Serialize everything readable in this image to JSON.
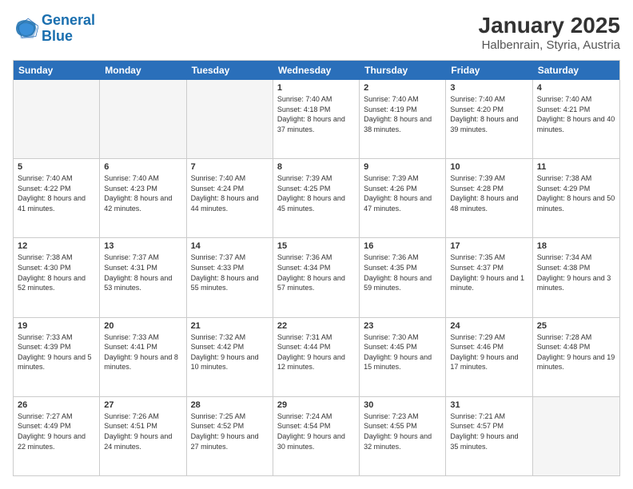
{
  "logo": {
    "line1": "General",
    "line2": "Blue"
  },
  "title": "January 2025",
  "subtitle": "Halbenrain, Styria, Austria",
  "header_days": [
    "Sunday",
    "Monday",
    "Tuesday",
    "Wednesday",
    "Thursday",
    "Friday",
    "Saturday"
  ],
  "rows": [
    [
      {
        "day": "",
        "info": "",
        "empty": true
      },
      {
        "day": "",
        "info": "",
        "empty": true
      },
      {
        "day": "",
        "info": "",
        "empty": true
      },
      {
        "day": "1",
        "info": "Sunrise: 7:40 AM\nSunset: 4:18 PM\nDaylight: 8 hours and 37 minutes."
      },
      {
        "day": "2",
        "info": "Sunrise: 7:40 AM\nSunset: 4:19 PM\nDaylight: 8 hours and 38 minutes."
      },
      {
        "day": "3",
        "info": "Sunrise: 7:40 AM\nSunset: 4:20 PM\nDaylight: 8 hours and 39 minutes."
      },
      {
        "day": "4",
        "info": "Sunrise: 7:40 AM\nSunset: 4:21 PM\nDaylight: 8 hours and 40 minutes."
      }
    ],
    [
      {
        "day": "5",
        "info": "Sunrise: 7:40 AM\nSunset: 4:22 PM\nDaylight: 8 hours and 41 minutes."
      },
      {
        "day": "6",
        "info": "Sunrise: 7:40 AM\nSunset: 4:23 PM\nDaylight: 8 hours and 42 minutes."
      },
      {
        "day": "7",
        "info": "Sunrise: 7:40 AM\nSunset: 4:24 PM\nDaylight: 8 hours and 44 minutes."
      },
      {
        "day": "8",
        "info": "Sunrise: 7:39 AM\nSunset: 4:25 PM\nDaylight: 8 hours and 45 minutes."
      },
      {
        "day": "9",
        "info": "Sunrise: 7:39 AM\nSunset: 4:26 PM\nDaylight: 8 hours and 47 minutes."
      },
      {
        "day": "10",
        "info": "Sunrise: 7:39 AM\nSunset: 4:28 PM\nDaylight: 8 hours and 48 minutes."
      },
      {
        "day": "11",
        "info": "Sunrise: 7:38 AM\nSunset: 4:29 PM\nDaylight: 8 hours and 50 minutes."
      }
    ],
    [
      {
        "day": "12",
        "info": "Sunrise: 7:38 AM\nSunset: 4:30 PM\nDaylight: 8 hours and 52 minutes."
      },
      {
        "day": "13",
        "info": "Sunrise: 7:37 AM\nSunset: 4:31 PM\nDaylight: 8 hours and 53 minutes."
      },
      {
        "day": "14",
        "info": "Sunrise: 7:37 AM\nSunset: 4:33 PM\nDaylight: 8 hours and 55 minutes."
      },
      {
        "day": "15",
        "info": "Sunrise: 7:36 AM\nSunset: 4:34 PM\nDaylight: 8 hours and 57 minutes."
      },
      {
        "day": "16",
        "info": "Sunrise: 7:36 AM\nSunset: 4:35 PM\nDaylight: 8 hours and 59 minutes."
      },
      {
        "day": "17",
        "info": "Sunrise: 7:35 AM\nSunset: 4:37 PM\nDaylight: 9 hours and 1 minute."
      },
      {
        "day": "18",
        "info": "Sunrise: 7:34 AM\nSunset: 4:38 PM\nDaylight: 9 hours and 3 minutes."
      }
    ],
    [
      {
        "day": "19",
        "info": "Sunrise: 7:33 AM\nSunset: 4:39 PM\nDaylight: 9 hours and 5 minutes."
      },
      {
        "day": "20",
        "info": "Sunrise: 7:33 AM\nSunset: 4:41 PM\nDaylight: 9 hours and 8 minutes."
      },
      {
        "day": "21",
        "info": "Sunrise: 7:32 AM\nSunset: 4:42 PM\nDaylight: 9 hours and 10 minutes."
      },
      {
        "day": "22",
        "info": "Sunrise: 7:31 AM\nSunset: 4:44 PM\nDaylight: 9 hours and 12 minutes."
      },
      {
        "day": "23",
        "info": "Sunrise: 7:30 AM\nSunset: 4:45 PM\nDaylight: 9 hours and 15 minutes."
      },
      {
        "day": "24",
        "info": "Sunrise: 7:29 AM\nSunset: 4:46 PM\nDaylight: 9 hours and 17 minutes."
      },
      {
        "day": "25",
        "info": "Sunrise: 7:28 AM\nSunset: 4:48 PM\nDaylight: 9 hours and 19 minutes."
      }
    ],
    [
      {
        "day": "26",
        "info": "Sunrise: 7:27 AM\nSunset: 4:49 PM\nDaylight: 9 hours and 22 minutes."
      },
      {
        "day": "27",
        "info": "Sunrise: 7:26 AM\nSunset: 4:51 PM\nDaylight: 9 hours and 24 minutes."
      },
      {
        "day": "28",
        "info": "Sunrise: 7:25 AM\nSunset: 4:52 PM\nDaylight: 9 hours and 27 minutes."
      },
      {
        "day": "29",
        "info": "Sunrise: 7:24 AM\nSunset: 4:54 PM\nDaylight: 9 hours and 30 minutes."
      },
      {
        "day": "30",
        "info": "Sunrise: 7:23 AM\nSunset: 4:55 PM\nDaylight: 9 hours and 32 minutes."
      },
      {
        "day": "31",
        "info": "Sunrise: 7:21 AM\nSunset: 4:57 PM\nDaylight: 9 hours and 35 minutes."
      },
      {
        "day": "",
        "info": "",
        "empty": true
      }
    ]
  ]
}
